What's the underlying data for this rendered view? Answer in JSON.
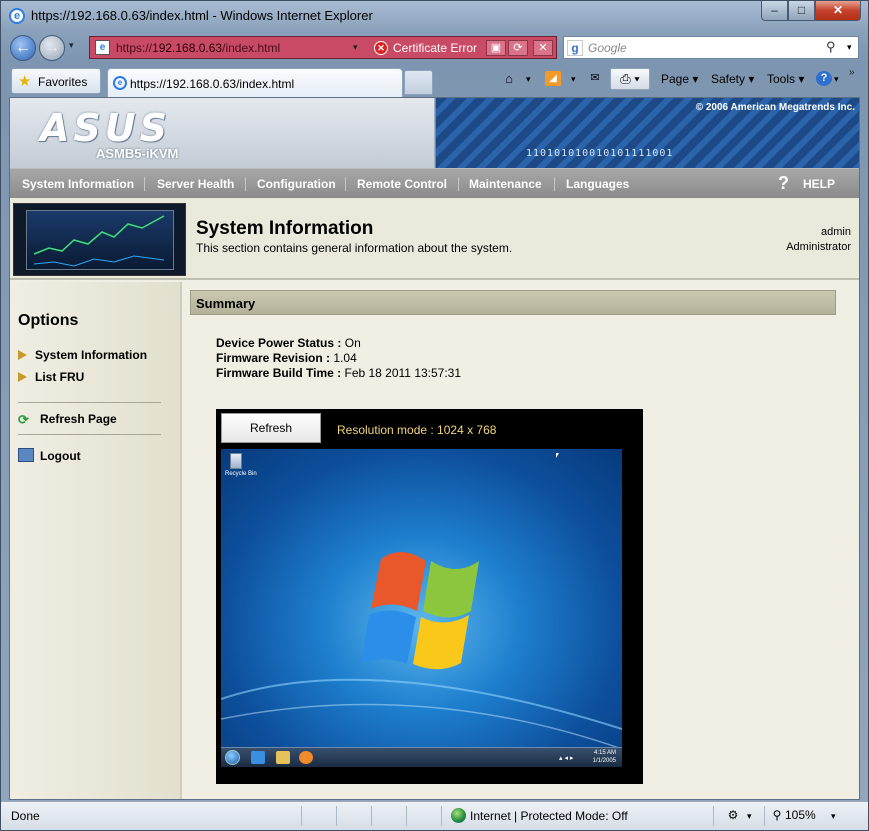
{
  "window": {
    "title": "https://192.168.0.63/index.html - Windows Internet Explorer",
    "min_glyph": "‒",
    "max_glyph": "□",
    "close_glyph": "✕"
  },
  "addressbar": {
    "url_prefix": "https://",
    "url_host": "192.168.0.63",
    "url_path": "/index.html",
    "cert_error": "Certificate Error",
    "dropdown_glyph": "▾"
  },
  "search": {
    "placeholder": "Google",
    "go_glyph": "⚲",
    "dropdown_glyph": "▾"
  },
  "tabs": {
    "favorites_label": "Favorites",
    "current_tab": "https://192.168.0.63/index.html"
  },
  "commandbar": {
    "page": "Page",
    "safety": "Safety",
    "tools": "Tools",
    "help_glyph": "?",
    "dropdown_glyph": "▾",
    "chevron": "»"
  },
  "banner": {
    "brand": "ASUS",
    "model": "ASMB5-iKVM",
    "copyright": "© 2006 American Megatrends Inc.",
    "binary_text": "110101010010101111001"
  },
  "menu": {
    "items": [
      "System Information",
      "Server Health",
      "Configuration",
      "Remote Control",
      "Maintenance",
      "Languages"
    ],
    "help_label": "HELP",
    "help_glyph": "?"
  },
  "header": {
    "title": "System Information",
    "description": "This section contains general information about the system.",
    "user": "admin",
    "role": "Administrator"
  },
  "sidebar": {
    "title": "Options",
    "items": [
      "System Information",
      "List FRU"
    ],
    "refresh": "Refresh Page",
    "logout": "Logout"
  },
  "summary": {
    "heading": "Summary",
    "power_label": "Device Power Status :",
    "power_value": "On",
    "fw_label": "Firmware Revision :",
    "fw_value": "1.04",
    "build_label": "Firmware Build Time :",
    "build_value": "Feb 18 2011 13:57:31"
  },
  "kvm": {
    "refresh_label": "Refresh",
    "resolution": "Resolution mode : 1024 x 768",
    "recycle_bin": "Recycle Bin",
    "clock_time": "4:15 AM",
    "clock_date": "1/1/2005"
  },
  "statusbar": {
    "status": "Done",
    "zone": "Internet | Protected Mode: Off",
    "zoom": "105%"
  },
  "colors": {
    "cert_error_bg": "#c84a64",
    "menu_bg": "#8b8b8b",
    "summary_bg": "#cbc9b2",
    "resolution_text": "#f2d67c"
  }
}
